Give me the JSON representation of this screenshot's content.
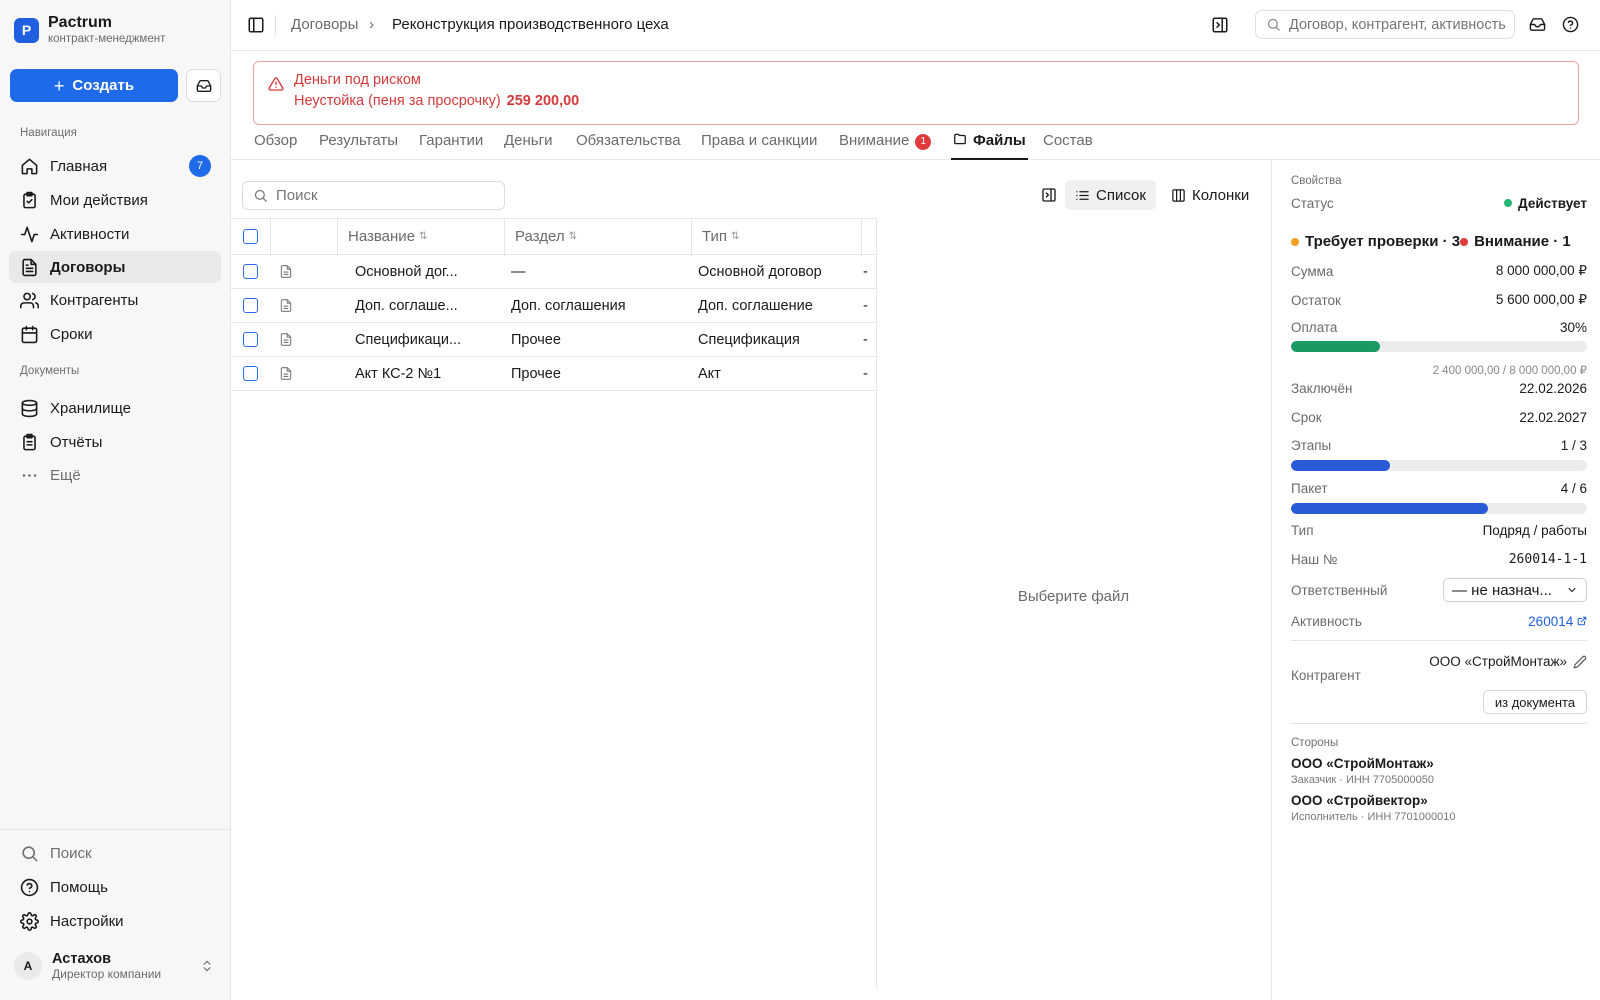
{
  "brand": {
    "logo_letter": "P",
    "name": "Pactrum",
    "subtitle": "контракт-менеджмент"
  },
  "sidebar": {
    "create_label": "Создать",
    "nav_label": "Навигация",
    "nav_items": [
      {
        "label": "Главная",
        "icon": "home-icon",
        "badge": "7"
      },
      {
        "label": "Мои действия",
        "icon": "clipboard-check-icon"
      },
      {
        "label": "Активности",
        "icon": "activity-icon"
      },
      {
        "label": "Договоры",
        "icon": "file-text-icon",
        "active": true
      },
      {
        "label": "Контрагенты",
        "icon": "users-icon"
      },
      {
        "label": "Сроки",
        "icon": "calendar-icon"
      }
    ],
    "docs_label": "Документы",
    "doc_items": [
      {
        "label": "Хранилище",
        "icon": "database-icon"
      },
      {
        "label": "Отчёты",
        "icon": "clipboard-list-icon"
      },
      {
        "label": "Ещё",
        "icon": "more-horizontal-icon"
      }
    ],
    "bottom_items": [
      {
        "label": "Поиск",
        "icon": "search-icon"
      },
      {
        "label": "Помощь",
        "icon": "help-circle-icon"
      },
      {
        "label": "Настройки",
        "icon": "settings-icon"
      }
    ],
    "user": {
      "initial": "А",
      "name": "Астахов",
      "role": "Директор компании"
    }
  },
  "topbar": {
    "breadcrumb_parent": "Договоры",
    "breadcrumb_current": "Реконструкция производственного цеха",
    "search_placeholder": "Договор, контрагент, активность"
  },
  "alert": {
    "title": "Деньги под риском",
    "text": "Неустойка (пеня за просрочку)",
    "amount": "259 200,00",
    "color": "#d43a3a"
  },
  "tabs": [
    {
      "label": "Обзор"
    },
    {
      "label": "Результаты"
    },
    {
      "label": "Гарантии"
    },
    {
      "label": "Деньги"
    },
    {
      "label": "Обязательства"
    },
    {
      "label": "Права и санкции"
    },
    {
      "label": "Внимание",
      "badge": "1"
    },
    {
      "label": "Файлы",
      "active": true,
      "icon": "folder-icon"
    },
    {
      "label": "Состав"
    }
  ],
  "files": {
    "search_placeholder": "Поиск",
    "view_list": "Список",
    "view_columns": "Колонки",
    "columns": [
      "Название",
      "Раздел",
      "Тип"
    ],
    "rows": [
      {
        "name": "Основной дог...",
        "section": "—",
        "type": "Основной договор",
        "extra": "-"
      },
      {
        "name": "Доп. соглаше...",
        "section": "Доп. соглашения",
        "type": "Доп. соглашение",
        "extra": "-"
      },
      {
        "name": "Спецификаци...",
        "section": "Прочее",
        "type": "Спецификация",
        "extra": "-"
      },
      {
        "name": "Акт КС-2 №1",
        "section": "Прочее",
        "type": "Акт",
        "extra": "-"
      }
    ],
    "empty_text": "Выберите файл"
  },
  "properties": {
    "heading": "Свойства",
    "status_label": "Статус",
    "status_value": "Действует",
    "status_color": "#22b573",
    "review_text": "Требует проверки · 3",
    "attention_text": "Внимание · 1",
    "review_color": "#f0a020",
    "attention_color": "#e03b3b",
    "sum_label": "Сумма",
    "sum_value": "8 000 000,00 ₽",
    "rest_label": "Остаток",
    "rest_value": "5 600 000,00 ₽",
    "pay_label": "Оплата",
    "pay_value": "30%",
    "pay_fraction": 0.3,
    "pay_sub": "2 400 000,00 / 8 000 000,00 ₽",
    "pay_color": "#1a9a62",
    "signed_label": "Заключён",
    "signed_value": "22.02.2026",
    "deadline_label": "Срок",
    "deadline_value": "22.02.2027",
    "stages_label": "Этапы",
    "stages_value": "1 / 3",
    "stages_fraction": 0.333,
    "package_label": "Пакет",
    "package_value": "4 / 6",
    "package_fraction": 0.667,
    "progress_color": "#2a5bd7",
    "type_label": "Тип",
    "type_value": "Подряд / работы",
    "number_label": "Наш №",
    "number_value": "260014-1-1",
    "responsible_label": "Ответственный",
    "responsible_value": "— не назнач...",
    "activity_label": "Активность",
    "activity_value": "260014",
    "counterparty_label": "Контрагент",
    "counterparty_value": "ООО «СтройМонтаж»",
    "from_doc_label": "из документа",
    "parties_label": "Стороны",
    "parties": [
      {
        "name": "ООО «СтройМонтаж»",
        "sub": "Заказчик · ИНН 7705000050"
      },
      {
        "name": "ООО «Стройвектор»",
        "sub": "Исполнитель · ИНН 7701000010"
      }
    ]
  }
}
